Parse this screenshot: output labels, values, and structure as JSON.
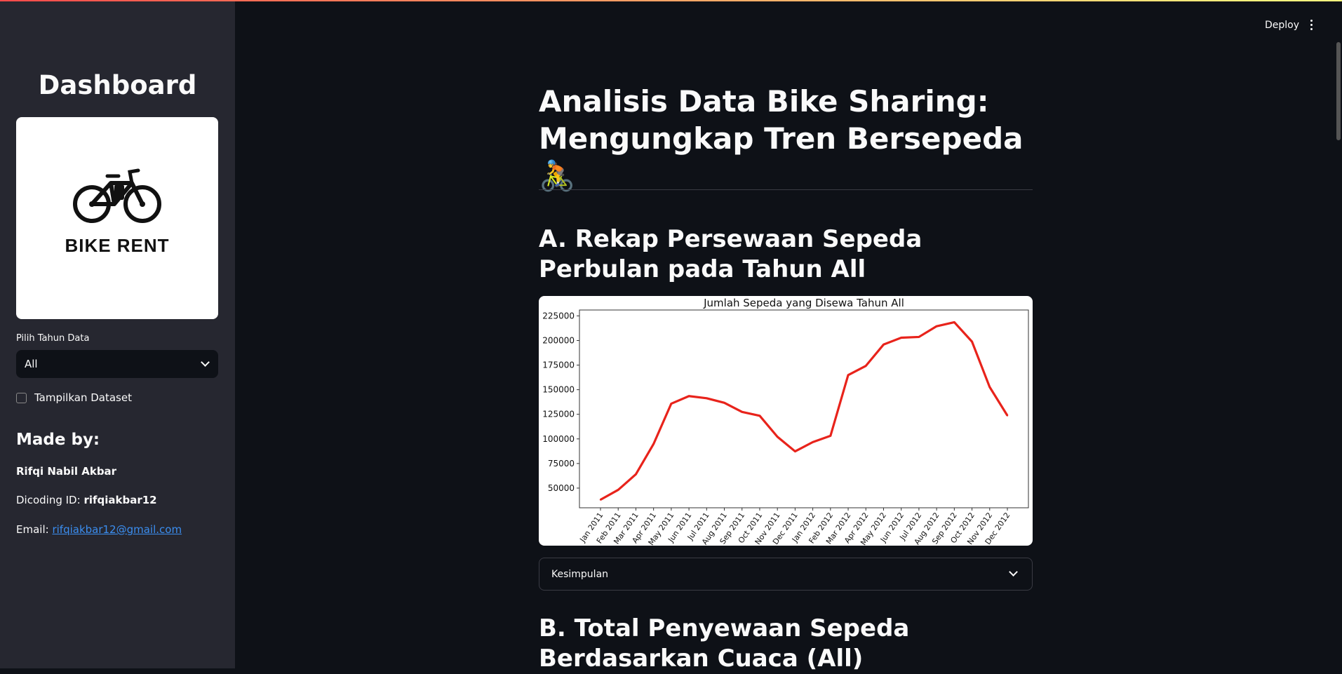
{
  "sidebar": {
    "title": "Dashboard",
    "logo_text": "BIKE RENT",
    "year_label": "Pilih Tahun Data",
    "year_value": "All",
    "dataset_checkbox": "Tampilkan Dataset",
    "made_by": "Made by:",
    "author": "Rifqi Nabil Akbar",
    "dicoding_label": "Dicoding ID: ",
    "dicoding_id": "rifqiakbar12",
    "email_label": "Email: ",
    "email": "rifqiakbar12@gmail.com"
  },
  "header": {
    "deploy": "Deploy"
  },
  "main": {
    "title_line1": "Analisis Data Bike Sharing:",
    "title_line2": "Mengungkap Tren Bersepeda 🚴",
    "section_a": "A. Rekap Persewaan Sepeda Perbulan pada Tahun All",
    "expander": "Kesimpulan",
    "section_b": "B. Total Penyewaan Sepeda Berdasarkan Cuaca (All)"
  },
  "colors": {
    "accent": "#ff4b4b",
    "line": "#e8231b",
    "link": "#3b8ef0"
  },
  "chart_data": {
    "type": "line",
    "title": "Jumlah Sepeda yang Disewa Tahun All",
    "xlabel": "",
    "ylabel": "",
    "categories": [
      "Jan 2011",
      "Feb 2011",
      "Mar 2011",
      "Apr 2011",
      "May 2011",
      "Jun 2011",
      "Jul 2011",
      "Aug 2011",
      "Sep 2011",
      "Oct 2011",
      "Nov 2011",
      "Dec 2011",
      "Jan 2012",
      "Feb 2012",
      "Mar 2012",
      "Apr 2012",
      "May 2012",
      "Jun 2012",
      "Jul 2012",
      "Aug 2012",
      "Sep 2012",
      "Oct 2012",
      "Nov 2012",
      "Dec 2012"
    ],
    "values": [
      38189,
      48215,
      64045,
      94870,
      135821,
      143512,
      141341,
      136691,
      127418,
      123511,
      102167,
      87323,
      96744,
      103137,
      164875,
      174224,
      195865,
      202830,
      203607,
      214503,
      218573,
      198841,
      152664,
      123713
    ],
    "yticks": [
      50000,
      75000,
      100000,
      125000,
      150000,
      175000,
      200000,
      225000
    ],
    "ylim": [
      30000,
      231000
    ],
    "grid": false
  }
}
